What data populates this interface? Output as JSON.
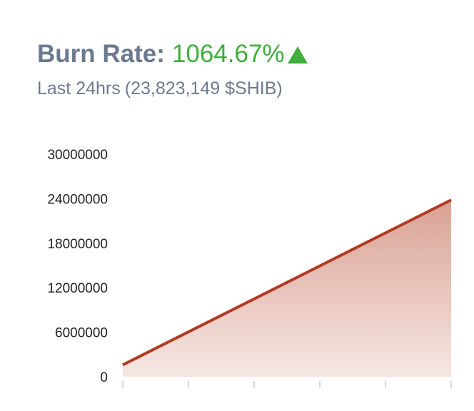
{
  "header": {
    "title_label": "Burn Rate:",
    "title_value": "1064.67%",
    "subtitle_label": "Last 24hrs",
    "subtitle_value": "(23,823,149 $SHIB)"
  },
  "colors": {
    "label": "#6b7a90",
    "positive": "#3fae3c",
    "line": "#b03a25",
    "fill_top": "#d9a193",
    "fill_bottom": "#f6e7e3",
    "axis": "#c9cdd3"
  },
  "icons": {
    "trend": "up-arrow-icon"
  },
  "chart_data": {
    "type": "area",
    "title": "",
    "xlabel": "",
    "ylabel": "",
    "x": [
      0,
      1
    ],
    "series": [
      {
        "values": [
          1600000,
          23823149
        ]
      }
    ],
    "ylim": [
      0,
      30000000
    ],
    "yticks": [
      "0",
      "6000000",
      "12000000",
      "18000000",
      "24000000",
      "30000000"
    ],
    "x_tick_count": 6,
    "grid": false,
    "legend": "none"
  }
}
